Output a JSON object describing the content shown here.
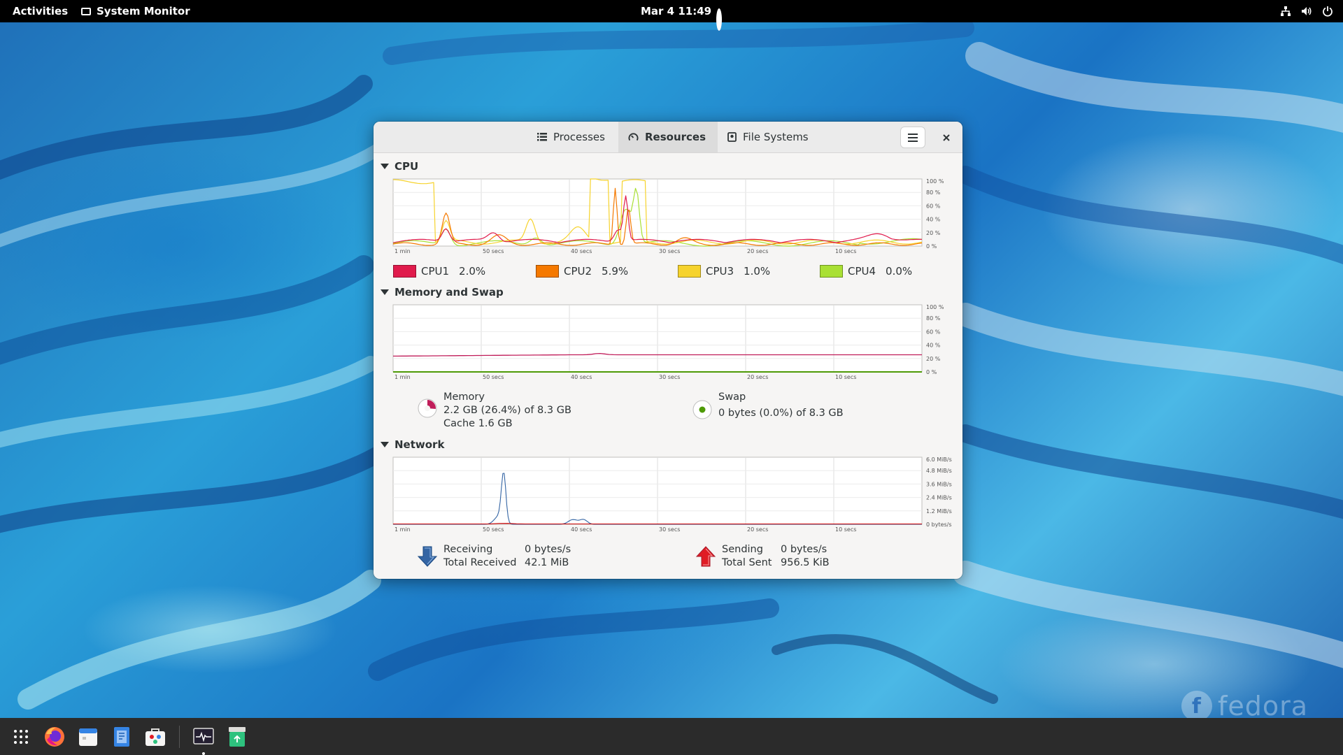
{
  "top_bar": {
    "activities": "Activities",
    "app_name": "System Monitor",
    "clock": "Mar 4  11:49"
  },
  "wallpaper": {
    "brand": "fedora"
  },
  "dock": {
    "items": [
      "show-apps-grid-icon",
      "firefox-icon",
      "calendar-icon",
      "text-editor-icon",
      "software-icon",
      "system-monitor-icon",
      "trash-icon"
    ]
  },
  "window": {
    "tabs": [
      {
        "label": "Processes",
        "icon": "list-icon",
        "active": false
      },
      {
        "label": "Resources",
        "icon": "gauge-icon",
        "active": true
      },
      {
        "label": "File Systems",
        "icon": "disk-icon",
        "active": false
      }
    ],
    "cpu": {
      "title": "CPU",
      "time_labels": [
        "1 min",
        "50 secs",
        "40 secs",
        "30 secs",
        "20 secs",
        "10 secs"
      ],
      "y_labels": [
        "100 %",
        "80 %",
        "60 %",
        "40 %",
        "20 %",
        "0 %"
      ],
      "legend": [
        {
          "label": "CPU1",
          "value": "2.0%",
          "color": "#e01b4c"
        },
        {
          "label": "CPU2",
          "value": "5.9%",
          "color": "#f57900"
        },
        {
          "label": "CPU3",
          "value": "1.0%",
          "color": "#f6d32d"
        },
        {
          "label": "CPU4",
          "value": "0.0%",
          "color": "#a9e034"
        }
      ]
    },
    "memory": {
      "title": "Memory and Swap",
      "time_labels": [
        "1 min",
        "50 secs",
        "40 secs",
        "30 secs",
        "20 secs",
        "10 secs"
      ],
      "y_labels": [
        "100 %",
        "80 %",
        "60 %",
        "40 %",
        "20 %",
        "0 %"
      ],
      "memory_label": "Memory",
      "memory_usage": "2.2 GB (26.4%) of 8.3 GB",
      "memory_cache": "Cache 1.6 GB",
      "memory_color": "#c01c59",
      "memory_fraction": 0.264,
      "swap_label": "Swap",
      "swap_usage": "0 bytes (0.0%) of 8.3 GB",
      "swap_color": "#4e9a06"
    },
    "network": {
      "title": "Network",
      "time_labels": [
        "1 min",
        "50 secs",
        "40 secs",
        "30 secs",
        "20 secs",
        "10 secs"
      ],
      "y_labels": [
        "6.0 MiB/s",
        "4.8 MiB/s",
        "3.6 MiB/s",
        "2.4 MiB/s",
        "1.2 MiB/s",
        "0 bytes/s"
      ],
      "receiving_label": "Receiving",
      "receiving_value": "0 bytes/s",
      "total_received_label": "Total Received",
      "total_received_value": "42.1 MiB",
      "sending_label": "Sending",
      "sending_value": "0 bytes/s",
      "total_sent_label": "Total Sent",
      "total_sent_value": "956.5 KiB",
      "receiving_color": "#3465a4",
      "sending_color": "#cc0000"
    }
  }
}
